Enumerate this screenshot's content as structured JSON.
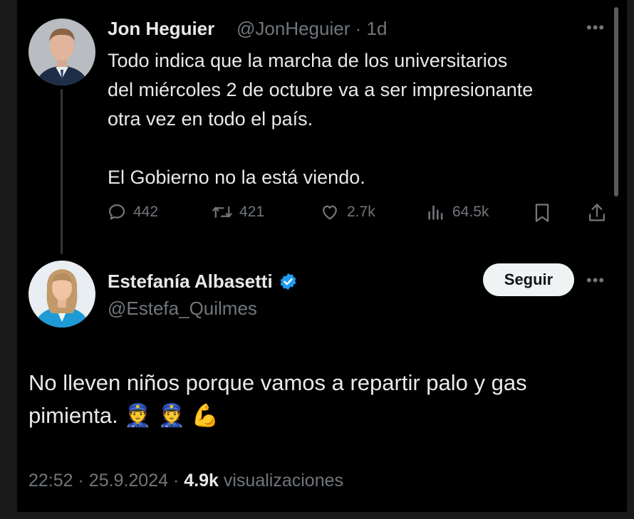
{
  "tweet": {
    "author_name": "Jon Heguier",
    "author_handle": "@JonHeguier",
    "separator": "·",
    "time": "1d",
    "text_lines": [
      "Todo indica que la marcha de los universitarios",
      "del miércoles 2 de octubre va a ser impresionante",
      "otra vez en todo el país."
    ],
    "text_line2": "El Gobierno no la está viendo.",
    "replies": "442",
    "retweets": "421",
    "likes": "2.7k",
    "views": "64.5k"
  },
  "reply": {
    "author_name": "Estefanía Albasetti",
    "author_handle": "@Estefa_Quilmes",
    "follow_label": "Seguir",
    "text": "No lleven niños porque vamos a repartir palo y gas pimienta. 👮 👮 💪",
    "time": "22:52",
    "dot": "·",
    "date": "25.9.2024",
    "view_count": "4.9k",
    "views_label": "visualizaciones"
  },
  "colors": {
    "background": "#000000",
    "text": "#e7e9ea",
    "muted": "#71767b",
    "verified": "#1d9bf0",
    "follow_bg": "#eff3f4"
  },
  "icons": [
    "reply-icon",
    "retweet-icon",
    "like-icon",
    "views-icon",
    "bookmark-icon",
    "share-icon",
    "more-icon",
    "verified-badge-icon"
  ]
}
